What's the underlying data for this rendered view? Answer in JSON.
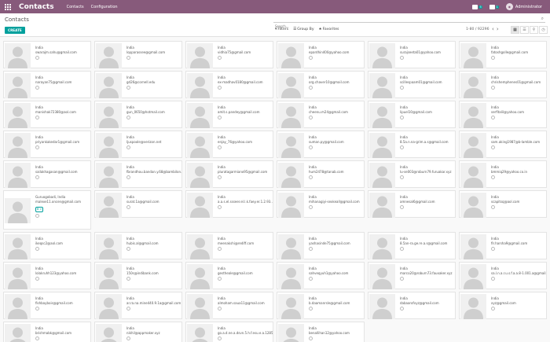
{
  "navbar": {
    "brand": "Contacts",
    "menu": [
      "Contacts",
      "Configuration"
    ],
    "messages_count": "5",
    "activities_count": "1",
    "user": "Administrator"
  },
  "control": {
    "title": "Contacts",
    "search_placeholder": "Search...",
    "create_label": "CREATE",
    "filters_label": "Filters",
    "groupby_label": "Group By",
    "favorites_label": "Favorites",
    "pager": "1-80 / 92296"
  },
  "cards": [
    {
      "country": "India",
      "email": "swarajm.sahu@gmail.com"
    },
    {
      "country": "India",
      "email": "lopparassee@gmail.com"
    },
    {
      "country": "India",
      "email": "vidhia75@gmail.com"
    },
    {
      "country": "India",
      "email": "epardhin400@yahoo.com"
    },
    {
      "country": "India",
      "email": "surajseeta01@yahoo.com"
    },
    {
      "country": "India",
      "email": "fatoshgolle@gmail.com"
    },
    {
      "country": "India",
      "email": "narayan75@gmail.com"
    },
    {
      "country": "India",
      "email": "gd26@cornell.edu"
    },
    {
      "country": "India",
      "email": "ex-madhav0180@gmail.com"
    },
    {
      "country": "India",
      "email": "org.chaver10@gmail.com"
    },
    {
      "country": "India",
      "email": "scillespaam01@gmail.com"
    },
    {
      "country": "India",
      "email": "chrishemphenes01@gmail.com"
    },
    {
      "country": "India",
      "email": "manishak72380@aol.com"
    },
    {
      "country": "India",
      "email": "gun_0650@hotmail.com"
    },
    {
      "country": "India",
      "email": "amit.s.pandey@gmail.com"
    },
    {
      "country": "India",
      "email": "cheenu.m24@gmail.com"
    },
    {
      "country": "India",
      "email": "lipuel10@gmail.com"
    },
    {
      "country": "India",
      "email": "serfitalil@yahoo.com"
    },
    {
      "country": "India",
      "email": "priyankakedar1@gmail.com"
    },
    {
      "country": "India",
      "email": "ljuspoole@verizon.net"
    },
    {
      "country": "India",
      "email": "enjay_76@yahoo.com"
    },
    {
      "country": "India",
      "email": "suman.py@gmail.com"
    },
    {
      "country": "India",
      "email": "8.5a.n.na-grim.a.s@gmail.com"
    },
    {
      "country": "India",
      "email": "sam.aking1987@b-lamble.com"
    },
    {
      "country": "India",
      "email": "sailakhagasan@gmail.com"
    },
    {
      "country": "India",
      "email": "fbrandhou.bandan.y.68@bambilon.com"
    },
    {
      "country": "India",
      "email": "pluratagarmiano95@gmail.com"
    },
    {
      "country": "India",
      "email": "hum2478@tanab.com"
    },
    {
      "country": "India",
      "email": "lu-se003@roburn79.furuakar.xyz"
    },
    {
      "country": "India",
      "email": "bmmiq29@yahoo.co.in"
    },
    {
      "country": "India",
      "email": "malexe11.oncen@gmail.com",
      "tall": true,
      "line1": "Guruogobadi, India",
      "tag": "B > "
    },
    {
      "country": "India",
      "email": "surat.1a@gmail.com"
    },
    {
      "country": "India",
      "email": "a.a.s.el.ssseer.el.l.k.faey.er.1.2.93..."
    },
    {
      "country": "India",
      "email": "mihanagiyi-sexkeall@gmail.com"
    },
    {
      "country": "India",
      "email": "amnesal6@gmail.com"
    },
    {
      "country": "India",
      "email": "scapitsq@aol.com"
    },
    {
      "country": "India",
      "email": "ikeqsc2@aol.com"
    },
    {
      "country": "India",
      "email": "hubis.al@gmail.com"
    },
    {
      "country": "India",
      "email": "meenakshi@rediff.com"
    },
    {
      "country": "India",
      "email": "yashasinde75@gmail.com"
    },
    {
      "country": "India",
      "email": "8.5an-ra.ge.re.a.s@gmail.com"
    },
    {
      "country": "India",
      "email": "fir.harsha9@gmail.com"
    },
    {
      "country": "India",
      "email": "lolakruhh123@yahoo.com"
    },
    {
      "country": "India",
      "email": "150s@indibank.com"
    },
    {
      "country": "India",
      "email": "gestheale@gmail.com"
    },
    {
      "country": "India",
      "email": "sahveqyuh1@yahoo.com"
    },
    {
      "country": "India",
      "email": "marco20@roburn73.fauxaker.xyz"
    },
    {
      "country": "India",
      "email": "sa.l.n.a.r.u.s.f.a.a.8-1.001.a@gmail.com"
    },
    {
      "country": "India",
      "email": "fishbaybois@gmail.com"
    },
    {
      "country": "India",
      "email": "ar.ra.na.mine440.9.1a@gmail.com"
    },
    {
      "country": "India",
      "email": "almoham.saua11@gmail.com"
    },
    {
      "country": "India",
      "email": "b.daamanrsle@gmail.com"
    },
    {
      "country": "India",
      "email": "dabaarofxyz@gmail.com"
    },
    {
      "country": "India",
      "email": "xyz@gmail.com"
    },
    {
      "country": "India",
      "email": "brishmabk@gmail.com"
    },
    {
      "country": "India",
      "email": "nikhil@appmaker.xyz"
    },
    {
      "country": "India",
      "email": "go.a.d.ne.a.dsvn.5.h.f.esu.e.a.1285..."
    },
    {
      "country": "India",
      "email": "benallihan12@yahoo.com"
    }
  ]
}
